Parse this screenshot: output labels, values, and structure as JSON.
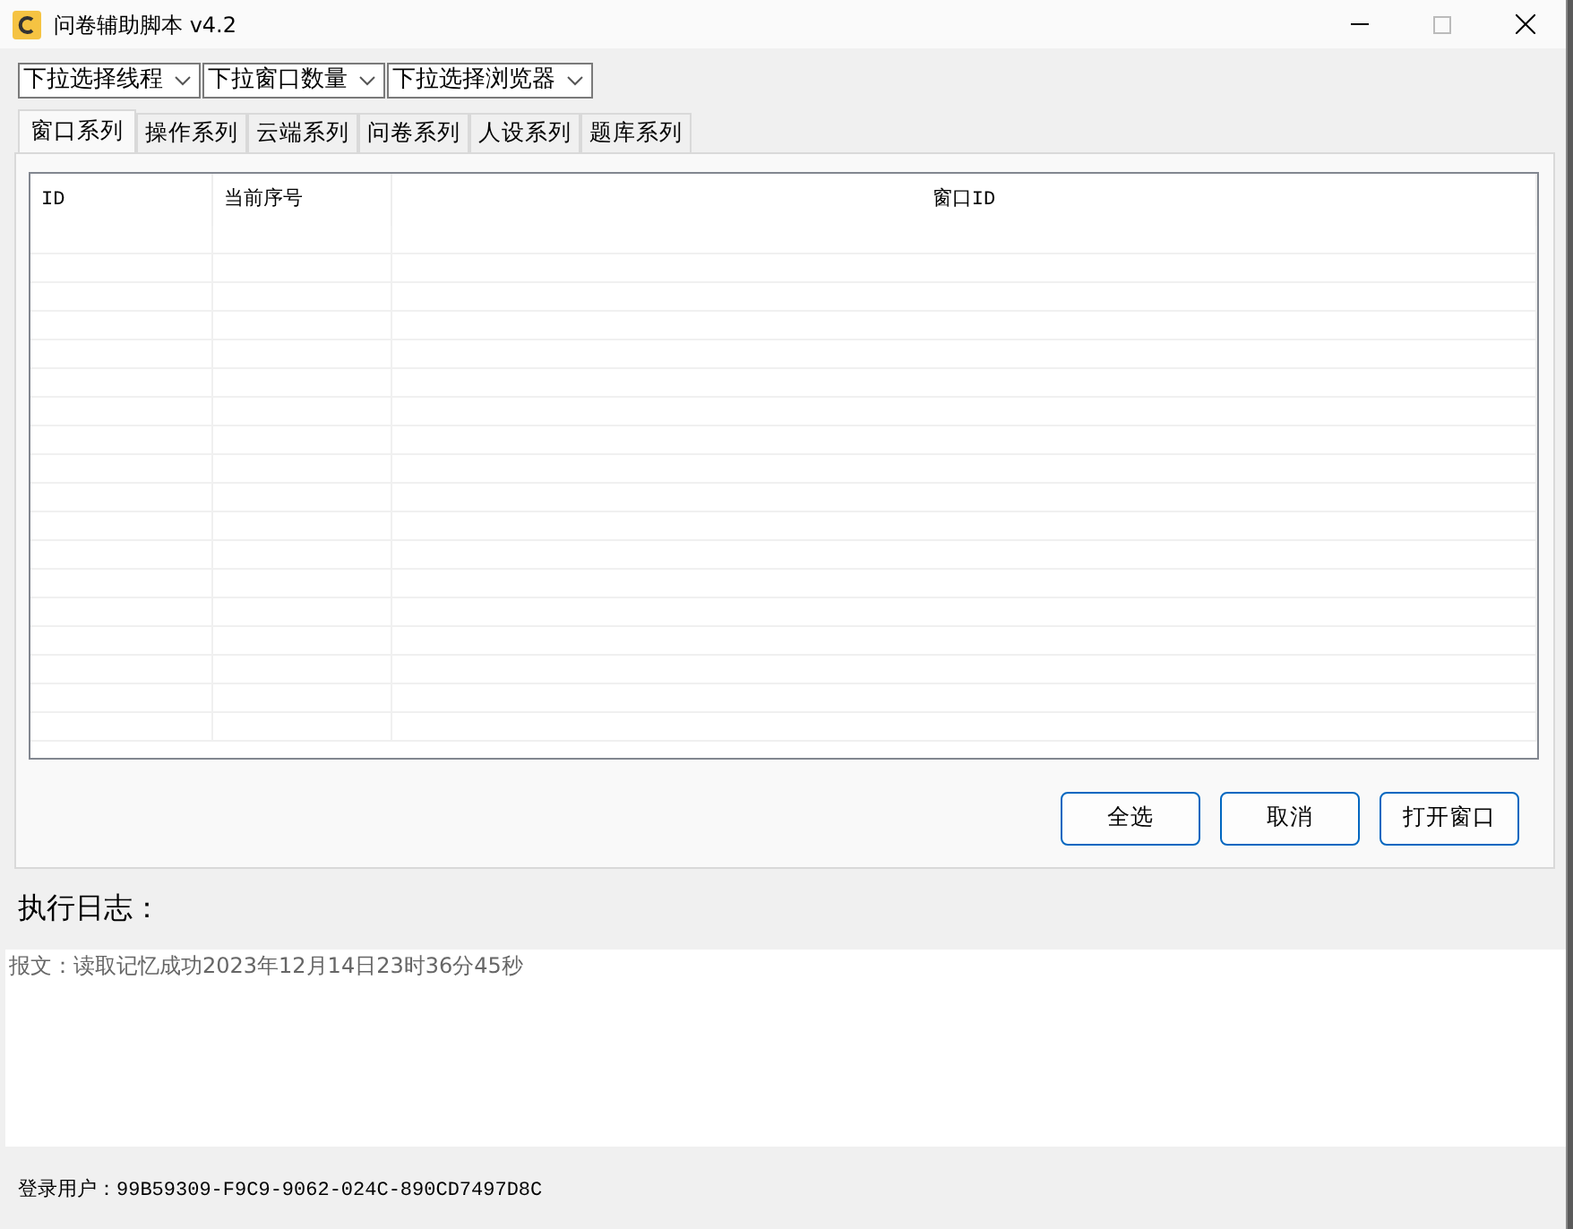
{
  "window": {
    "title": "问卷辅助脚本 v4.2"
  },
  "dropdowns": [
    {
      "label": "下拉选择线程"
    },
    {
      "label": "下拉窗口数量"
    },
    {
      "label": "下拉选择浏览器"
    }
  ],
  "tabs": [
    {
      "label": "窗口系列",
      "selected": true
    },
    {
      "label": "操作系列",
      "selected": false
    },
    {
      "label": "云端系列",
      "selected": false
    },
    {
      "label": "问卷系列",
      "selected": false
    },
    {
      "label": "人设系列",
      "selected": false
    },
    {
      "label": "题库系列",
      "selected": false
    }
  ],
  "table": {
    "columns": [
      "ID",
      "当前序号",
      "窗口ID"
    ]
  },
  "buttons": [
    "全选",
    "取消",
    "打开窗口"
  ],
  "log": {
    "title": "执行日志：",
    "lines": [
      "报文：读取记忆成功2023年12月14日23时36分45秒"
    ]
  },
  "status_bar": {
    "user": "登录用户：99B59309-F9C9-9062-024C-890CD7497D8C"
  }
}
